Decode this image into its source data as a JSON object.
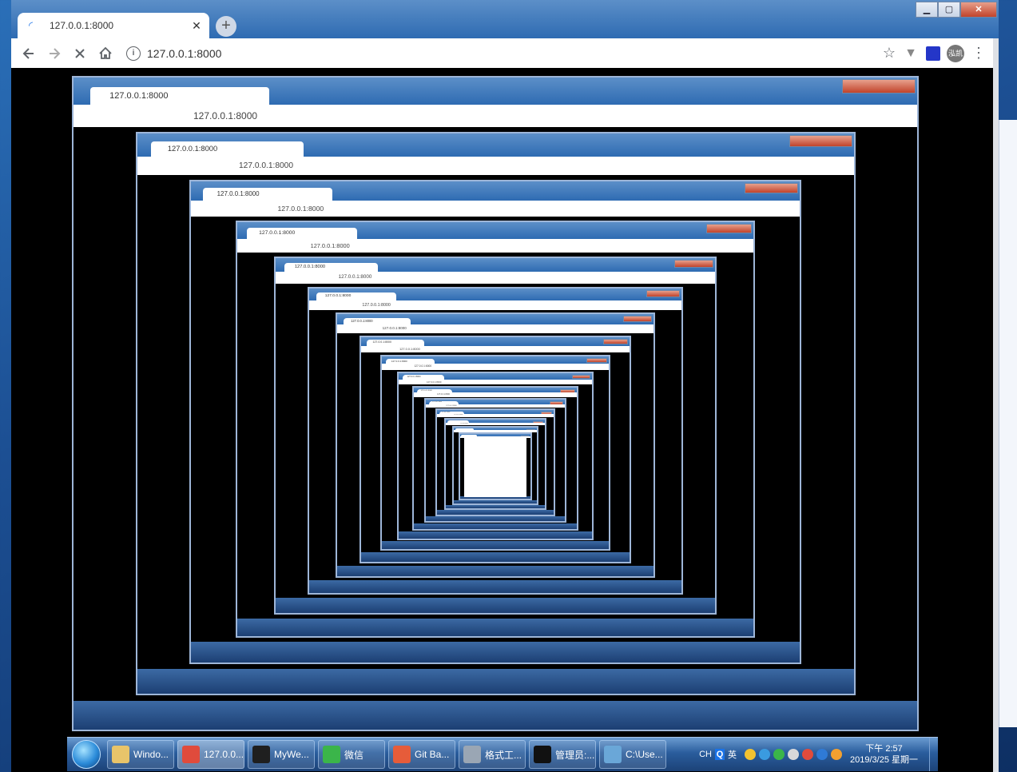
{
  "browser": {
    "tab_title": "127.0.0.1:8000",
    "tab_close": "✕",
    "new_tab": "+",
    "url": "127.0.0.1:8000",
    "avatar_text": "泓凯",
    "window_min": "▁",
    "window_max": "▢",
    "window_close": "✕"
  },
  "nested_page": {
    "tab_title": "127.0.0.1:8000",
    "url": "127.0.0.1:8000"
  },
  "taskbar": {
    "items": [
      {
        "label": "Windo...",
        "icon": "folder-icon",
        "color": "#e8c46a"
      },
      {
        "label": "127.0.0...",
        "icon": "chrome-icon",
        "color": "#e04b3c",
        "active": true
      },
      {
        "label": "MyWe...",
        "icon": "clion-icon",
        "color": "#1f1f1f"
      },
      {
        "label": "微信",
        "icon": "wechat-icon",
        "color": "#3bb54a"
      },
      {
        "label": "Git Ba...",
        "icon": "git-bash-icon",
        "color": "#e65c3a"
      },
      {
        "label": "格式工...",
        "icon": "format-factory-icon",
        "color": "#9aa6b4"
      },
      {
        "label": "管理员:...",
        "icon": "cmd-icon",
        "color": "#111111"
      },
      {
        "label": "C:\\Use...",
        "icon": "explorer-window-icon",
        "color": "#6aa7d8"
      }
    ],
    "ime_lang": "CH",
    "ime_mode": "英",
    "time": "下午 2:57",
    "date": "2019/3/25 星期一",
    "tray_colors": [
      "#f2c230",
      "#3a9be0",
      "#3bb54a",
      "#d9d9d9",
      "#e04b3c",
      "#2f7ad6",
      "#f2a030"
    ]
  }
}
